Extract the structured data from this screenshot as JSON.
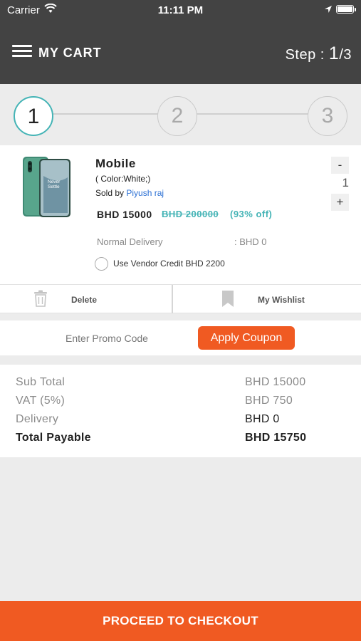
{
  "status_bar": {
    "carrier": "Carrier",
    "time": "11:11 PM"
  },
  "header": {
    "title": "MY CART",
    "step_prefix": "Step : ",
    "step_current": "1",
    "step_total": "/3"
  },
  "steps": [
    "1",
    "2",
    "3"
  ],
  "product": {
    "name": "Mobile",
    "color": "( Color:White;)",
    "sold_by_label": "Sold by",
    "seller": "Piyush raj",
    "price": "BHD 15000",
    "original_price": "BHD 200000",
    "discount": "(93% off)",
    "quantity": "1",
    "minus": "-",
    "plus": "+",
    "delivery_label": "Normal Delivery",
    "delivery_value": ": BHD 0",
    "vendor_credit": "Use Vendor Credit BHD 2200"
  },
  "actions": {
    "delete": "Delete",
    "wishlist": "My Wishlist"
  },
  "promo": {
    "placeholder": "Enter Promo Code",
    "apply": "Apply Coupon"
  },
  "totals": {
    "subtotal_label": "Sub Total",
    "subtotal_value": "BHD 15000",
    "vat_label": "VAT (5%)",
    "vat_value": "BHD 750",
    "delivery_label": "Delivery",
    "delivery_value": "BHD 0",
    "total_label": "Total Payable",
    "total_value": "BHD 15750"
  },
  "checkout": "PROCEED TO CHECKOUT",
  "colors": {
    "header_bg": "#434343",
    "accent": "#f05a22",
    "teal": "#45b4b6",
    "link": "#2a6fd4"
  }
}
